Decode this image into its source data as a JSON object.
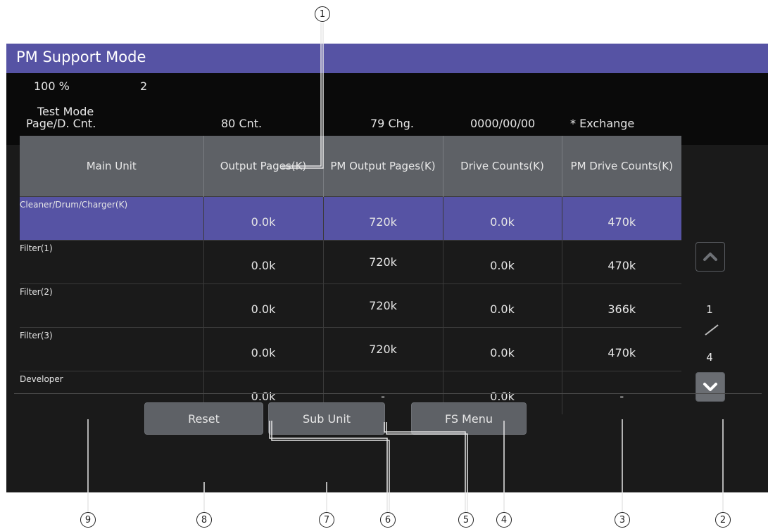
{
  "title": "PM Support Mode",
  "status": {
    "zoom": "100 %",
    "copies": "2",
    "mode": "Test Mode"
  },
  "info_row": {
    "label": "Page/D. Cnt.",
    "count": "80 Cnt.",
    "change": "79 Chg.",
    "date": "0000/00/00",
    "exchange": "* Exchange"
  },
  "table": {
    "headers": [
      "Main Unit",
      "Output Pages(K)",
      "PM Output Pages(K)",
      "Drive Counts(K)",
      "PM Drive Counts(K)"
    ],
    "rows": [
      {
        "name": "Cleaner/Drum/Charger(K)",
        "output": "0.0k",
        "pm_output": "720k",
        "drive": "0.0k",
        "pm_drive": "470k",
        "selected": true
      },
      {
        "name": "Filter(1)",
        "output": "0.0k",
        "pm_output": "720k",
        "drive": "0.0k",
        "pm_drive": "470k"
      },
      {
        "name": "Filter(2)",
        "output": "0.0k",
        "pm_output": "720k",
        "drive": "0.0k",
        "pm_drive": "366k"
      },
      {
        "name": "Filter(3)",
        "output": "0.0k",
        "pm_output": "720k",
        "drive": "0.0k",
        "pm_drive": "470k"
      },
      {
        "name": "Developer",
        "output": "0.0k",
        "pm_output": "-",
        "drive": "0.0k",
        "pm_drive": "-"
      }
    ]
  },
  "pagination": {
    "current": "1",
    "separator": "/",
    "total": "4"
  },
  "buttons": {
    "reset": "Reset",
    "sub_unit": "Sub Unit",
    "fs_menu": "FS Menu"
  },
  "icons": {
    "up": "chevron-up-icon",
    "down": "chevron-down-icon"
  },
  "colors": {
    "titlebar": "#5653a4",
    "selected_row": "#5653a4",
    "header": "#5e6166"
  },
  "callouts": [
    "1",
    "2",
    "3",
    "4",
    "5",
    "6",
    "7",
    "8",
    "9"
  ]
}
